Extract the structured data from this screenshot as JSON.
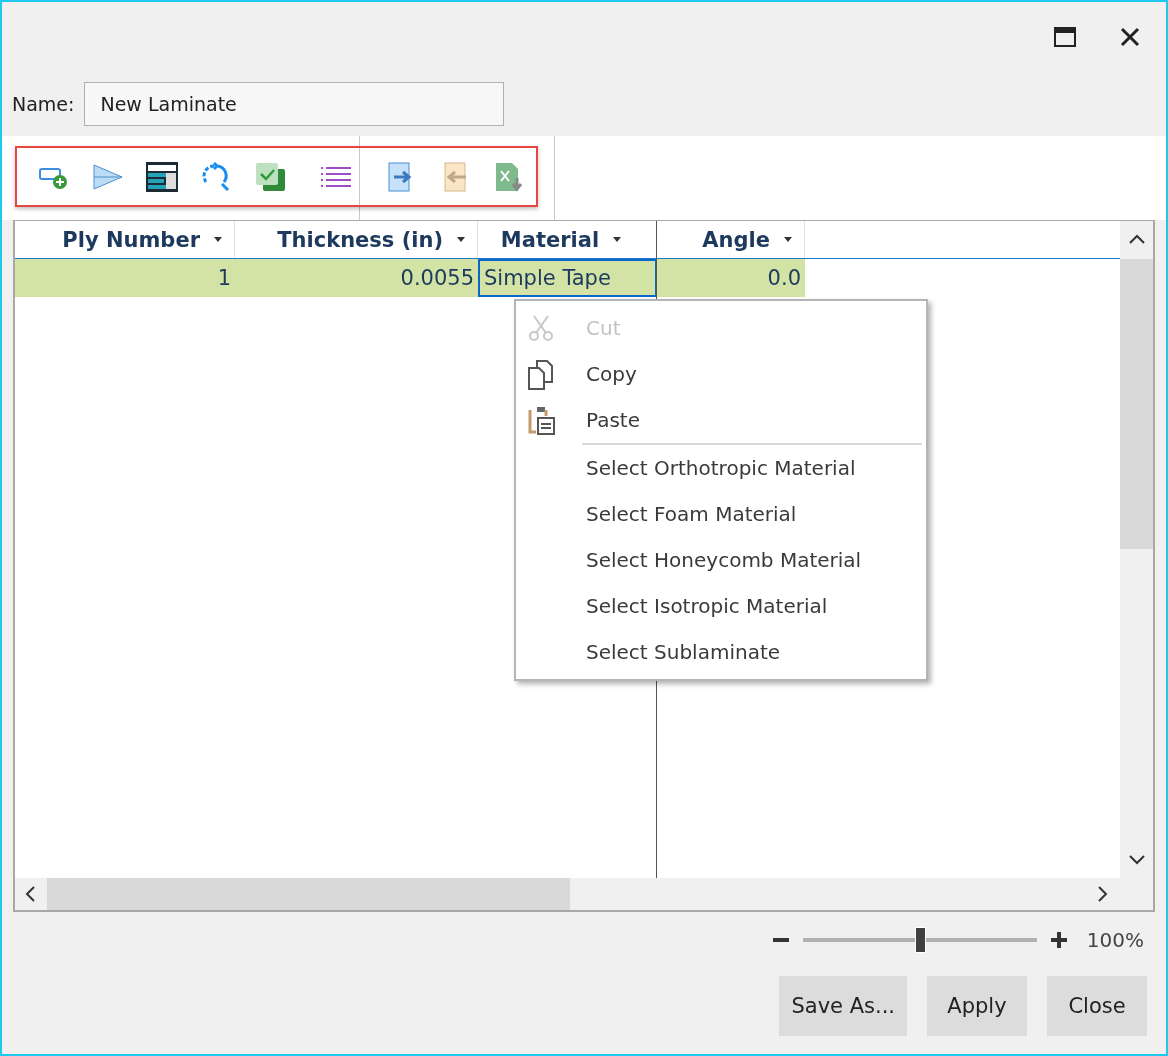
{
  "name_field": {
    "label": "Name:",
    "value": "New Laminate"
  },
  "table": {
    "columns": [
      {
        "label": "Ply Number"
      },
      {
        "label": "Thickness (in)"
      },
      {
        "label": "Material"
      },
      {
        "label": "Angle"
      }
    ],
    "rows": [
      {
        "selected": true,
        "cells": [
          {
            "text": "1",
            "focused": false
          },
          {
            "text": "0.0055",
            "focused": false
          },
          {
            "text": "Simple Tape",
            "focused": true
          },
          {
            "text": "0.0",
            "focused": false
          }
        ]
      }
    ]
  },
  "context_menu": {
    "items": [
      {
        "kind": "command",
        "label": "Cut",
        "disabled": true
      },
      {
        "kind": "command",
        "label": "Copy",
        "disabled": false
      },
      {
        "kind": "command",
        "label": "Paste",
        "disabled": false
      },
      {
        "kind": "separator"
      },
      {
        "kind": "command",
        "label": "Select Orthotropic Material",
        "disabled": false
      },
      {
        "kind": "command",
        "label": "Select Foam Material",
        "disabled": false
      },
      {
        "kind": "command",
        "label": "Select Honeycomb Material",
        "disabled": false
      },
      {
        "kind": "command",
        "label": "Select Isotropic Material",
        "disabled": false
      },
      {
        "kind": "command",
        "label": "Select Sublaminate",
        "disabled": false
      }
    ]
  },
  "zoom": {
    "level": 0.5,
    "reading": "100%"
  },
  "buttons": [
    "Save As...",
    "Apply",
    "Close"
  ]
}
